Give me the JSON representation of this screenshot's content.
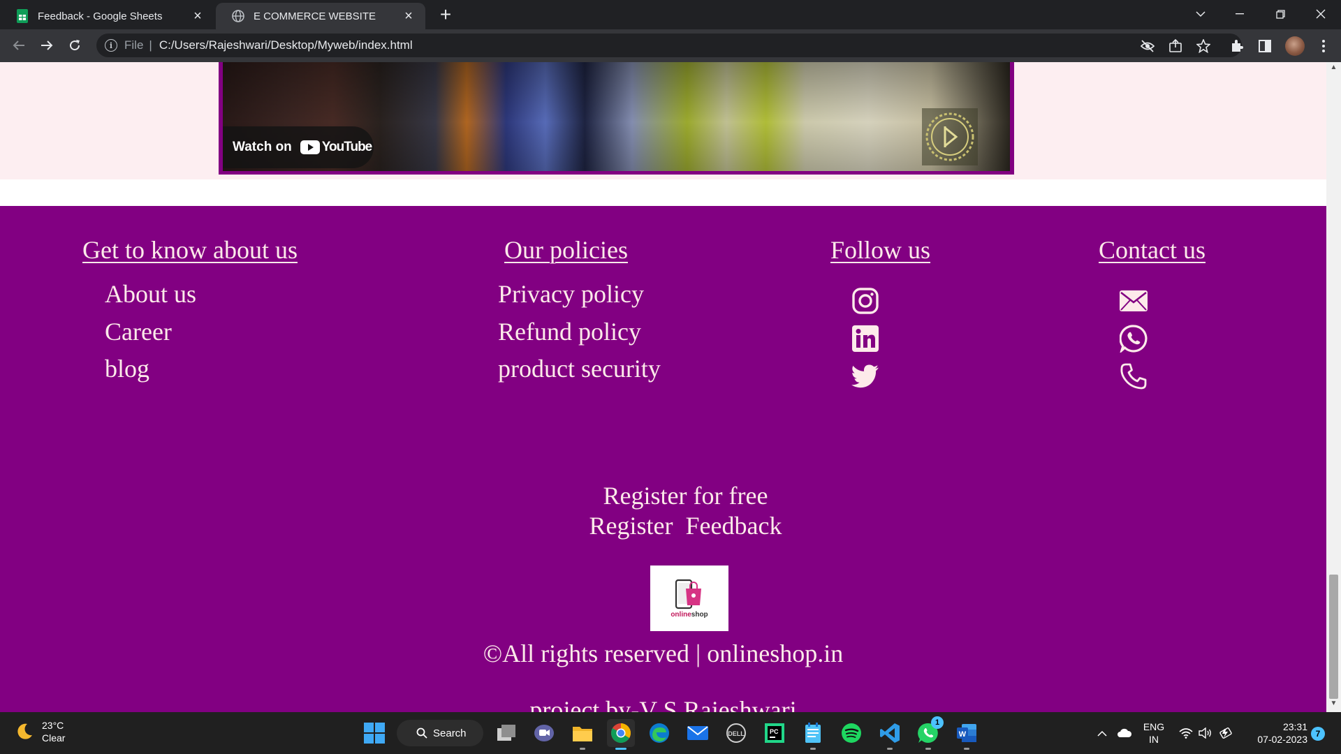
{
  "browser": {
    "tabs": [
      {
        "title": "Feedback - Google Sheets",
        "icon": "google-sheets-icon",
        "active": false
      },
      {
        "title": "E COMMERCE WEBSITE",
        "icon": "globe-icon",
        "active": true
      }
    ],
    "address": {
      "scheme": "File",
      "separator": "|",
      "url": "C:/Users/Rajeshwari/Desktop/Myweb/index.html"
    }
  },
  "video": {
    "watch_label": "Watch on",
    "platform": "YouTube"
  },
  "footer": {
    "columns": [
      {
        "title": "Get to know about us",
        "links": [
          "About us",
          "Career",
          "blog"
        ]
      },
      {
        "title": "Our policies",
        "links": [
          "Privacy policy",
          "Refund policy",
          "product security"
        ]
      },
      {
        "title": "Follow us",
        "icons": [
          "instagram-icon",
          "linkedin-icon",
          "twitter-icon"
        ]
      },
      {
        "title": "Contact us",
        "icons": [
          "mail-icon",
          "whatsapp-icon",
          "phone-icon"
        ]
      }
    ],
    "register_title": "Register for free",
    "register_link": "Register",
    "feedback_link": "Feedback",
    "logo": {
      "part1": "online",
      "part2": "shop"
    },
    "copyright": "©All rights reserved | onlineshop.in",
    "credit": "project by-V S Rajeshwari"
  },
  "colors": {
    "footer_bg": "#820082",
    "footer_text": "#fdeaea",
    "page_bg": "#fdeef1"
  },
  "taskbar": {
    "weather": {
      "temp": "23°C",
      "condition": "Clear"
    },
    "search_label": "Search",
    "whatsapp_badge": "1",
    "lang": {
      "line1": "ENG",
      "line2": "IN"
    },
    "time": "23:31",
    "date": "07-02-2023",
    "notification_count": "7"
  }
}
